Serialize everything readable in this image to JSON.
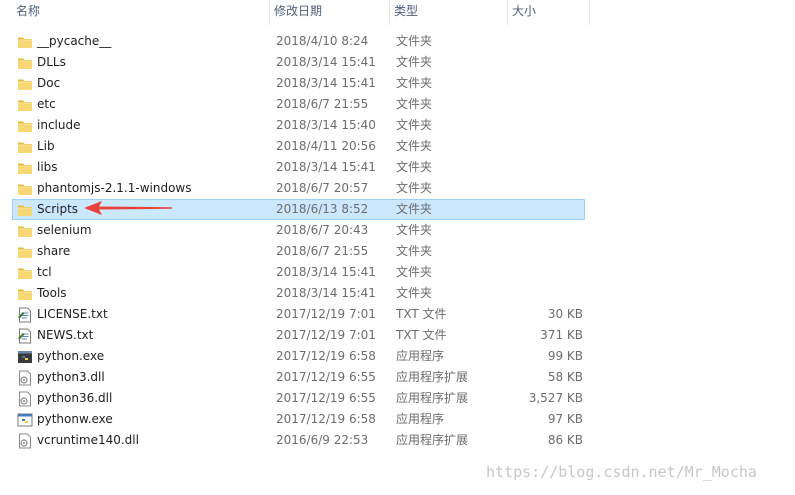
{
  "header": {
    "name": "名称",
    "date_modified": "修改日期",
    "type": "类型",
    "size": "大小",
    "sort_indicator": "^"
  },
  "files": [
    {
      "name": "__pycache__",
      "date": "2018/4/10 8:24",
      "type": "文件夹",
      "size": "",
      "icon": "folder-icon"
    },
    {
      "name": "DLLs",
      "date": "2018/3/14 15:41",
      "type": "文件夹",
      "size": "",
      "icon": "folder-icon"
    },
    {
      "name": "Doc",
      "date": "2018/3/14 15:41",
      "type": "文件夹",
      "size": "",
      "icon": "folder-icon"
    },
    {
      "name": "etc",
      "date": "2018/6/7 21:55",
      "type": "文件夹",
      "size": "",
      "icon": "folder-icon"
    },
    {
      "name": "include",
      "date": "2018/3/14 15:40",
      "type": "文件夹",
      "size": "",
      "icon": "folder-icon"
    },
    {
      "name": "Lib",
      "date": "2018/4/11 20:56",
      "type": "文件夹",
      "size": "",
      "icon": "folder-icon"
    },
    {
      "name": "libs",
      "date": "2018/3/14 15:41",
      "type": "文件夹",
      "size": "",
      "icon": "folder-icon"
    },
    {
      "name": "phantomjs-2.1.1-windows",
      "date": "2018/6/7 20:57",
      "type": "文件夹",
      "size": "",
      "icon": "folder-icon"
    },
    {
      "name": "Scripts",
      "date": "2018/6/13 8:52",
      "type": "文件夹",
      "size": "",
      "icon": "folder-icon",
      "selected": true
    },
    {
      "name": "selenium",
      "date": "2018/6/7 20:43",
      "type": "文件夹",
      "size": "",
      "icon": "folder-icon"
    },
    {
      "name": "share",
      "date": "2018/6/7 21:55",
      "type": "文件夹",
      "size": "",
      "icon": "folder-icon"
    },
    {
      "name": "tcl",
      "date": "2018/3/14 15:41",
      "type": "文件夹",
      "size": "",
      "icon": "folder-icon"
    },
    {
      "name": "Tools",
      "date": "2018/3/14 15:41",
      "type": "文件夹",
      "size": "",
      "icon": "folder-icon"
    },
    {
      "name": "LICENSE.txt",
      "date": "2017/12/19 7:01",
      "type": "TXT 文件",
      "size": "30 KB",
      "icon": "text-file-icon"
    },
    {
      "name": "NEWS.txt",
      "date": "2017/12/19 7:01",
      "type": "TXT 文件",
      "size": "371 KB",
      "icon": "text-file-icon"
    },
    {
      "name": "python.exe",
      "date": "2017/12/19 6:58",
      "type": "应用程序",
      "size": "99 KB",
      "icon": "python-exe-icon"
    },
    {
      "name": "python3.dll",
      "date": "2017/12/19 6:55",
      "type": "应用程序扩展",
      "size": "58 KB",
      "icon": "dll-file-icon"
    },
    {
      "name": "python36.dll",
      "date": "2017/12/19 6:55",
      "type": "应用程序扩展",
      "size": "3,527 KB",
      "icon": "dll-file-icon"
    },
    {
      "name": "pythonw.exe",
      "date": "2017/12/19 6:58",
      "type": "应用程序",
      "size": "97 KB",
      "icon": "pythonw-exe-icon"
    },
    {
      "name": "vcruntime140.dll",
      "date": "2016/6/9 22:53",
      "type": "应用程序扩展",
      "size": "86 KB",
      "icon": "dll-file-icon"
    }
  ],
  "watermark": "https://blog.csdn.net/Mr_Mocha",
  "colors": {
    "selection_bg": "#cce8ff",
    "selection_border": "#99d1ff",
    "folder": "#f8d775",
    "arrow": "#e8413a"
  }
}
